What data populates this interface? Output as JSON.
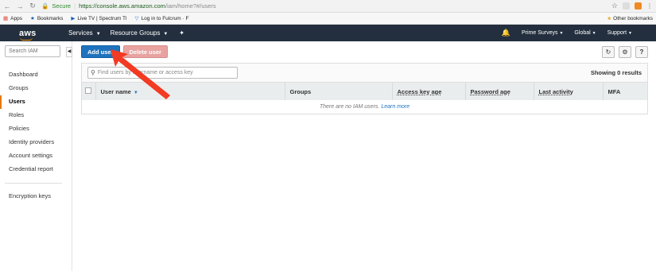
{
  "browser": {
    "secure_label": "Secure",
    "url_host": "https://console.aws.amazon.com",
    "url_path": "/iam/home?#/users",
    "bookmarks": [
      {
        "icon": "apps-grid-icon",
        "label": "Apps"
      },
      {
        "icon": "star-icon",
        "label": "Bookmarks"
      },
      {
        "icon": "play-icon",
        "label": "Live TV | Spectrum Tl"
      },
      {
        "icon": "fulcrum-icon",
        "label": "Log in to Fulcrum · F"
      }
    ],
    "other_bookmarks": "Other bookmarks"
  },
  "awsnav": {
    "logo": "aws",
    "services": "Services",
    "resource_groups": "Resource Groups",
    "account": "Prime Surveys",
    "region": "Global",
    "support": "Support"
  },
  "sidebar": {
    "search_placeholder": "Search IAM",
    "items": [
      "Dashboard",
      "Groups",
      "Users",
      "Roles",
      "Policies",
      "Identity providers",
      "Account settings",
      "Credential report"
    ],
    "active": "Users",
    "extra_items": [
      "Encryption keys"
    ]
  },
  "toolbar": {
    "add_user": "Add user",
    "delete_user": "Delete user"
  },
  "filter": {
    "placeholder": "Find users by username or access key",
    "showing": "Showing 0 results"
  },
  "table": {
    "columns": [
      "User name",
      "Groups",
      "Access key age",
      "Password age",
      "Last activity",
      "MFA"
    ],
    "empty_text": "There are no IAM users.",
    "learn_more": "Learn more"
  },
  "colors": {
    "aws_nav": "#232f3e",
    "primary_button": "#1e73be",
    "delete_button": "#e8a3a1",
    "annotation_arrow": "#f33a22"
  }
}
